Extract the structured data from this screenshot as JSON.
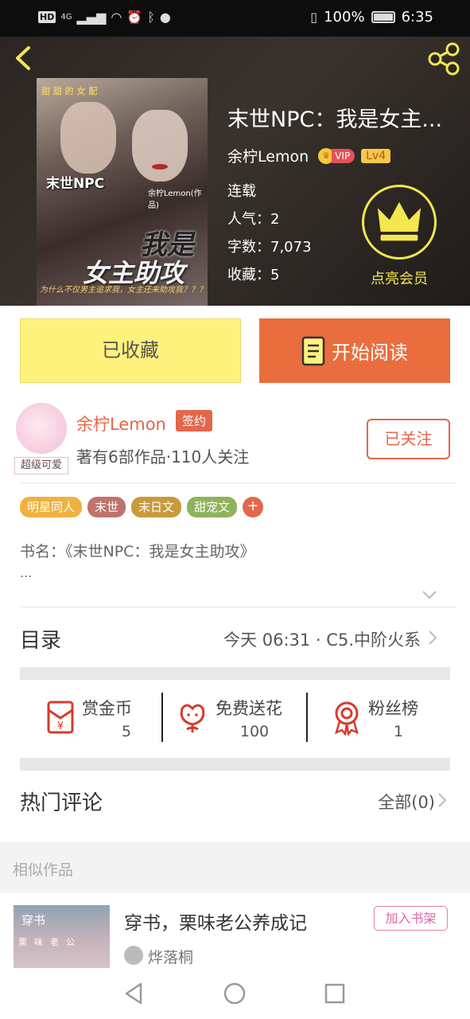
{
  "status_bar": {
    "hd": "HD",
    "network": "4G",
    "battery_pct": "100%",
    "time": "6:35"
  },
  "header": {
    "cover": {
      "top_text": "甜 甜 的 女 配",
      "title_line1": "末世NPC",
      "author": "余柠Lemon(作品)",
      "title_line2": "我是",
      "title_line3": "女主助攻",
      "tagline": "为什么不仅男主追求我，女主还来助攻我？？？"
    },
    "title": "末世NPC：我是女主...",
    "author": "余柠Lemon",
    "vip_label": "VIP",
    "level": "Lv4",
    "status": "连载",
    "popularity": "人气：2",
    "word_count": "字数：7,073",
    "favorites": "收藏：5",
    "vip_member_label": "点亮会员",
    "colors": {
      "accent_gold": "#f4e64e",
      "vip_red": "#e3515a"
    }
  },
  "actions": {
    "collected": "已收藏",
    "start_reading": "开始阅读"
  },
  "author_card": {
    "name": "余柠Lemon",
    "badge": "签约",
    "meta": "著有6部作品·110人关注",
    "avatar_tag": "超级可爱",
    "follow": "已关注"
  },
  "tags": [
    {
      "label": "明星同人",
      "color": "#f1b13f"
    },
    {
      "label": "末世",
      "color": "#c0736a"
    },
    {
      "label": "末日文",
      "color": "#c99a3c"
    },
    {
      "label": "甜宠文",
      "color": "#8fb25a"
    }
  ],
  "tag_more": "+",
  "synopsis": {
    "line1": "书名：《末世NPC：我是女主助攻》",
    "line2": "..."
  },
  "toc": {
    "label": "目录",
    "latest": "今天 06:31 · C5.中阶火系"
  },
  "stats": [
    {
      "label": "赏金币",
      "value": "5",
      "icon": "red-envelope-icon"
    },
    {
      "label": "免费送花",
      "value": "100",
      "icon": "flower-icon"
    },
    {
      "label": "粉丝榜",
      "value": "1",
      "icon": "medal-icon"
    }
  ],
  "comments": {
    "label": "热门评论",
    "all": "全部(0)"
  },
  "similar": {
    "label": "相似作品",
    "items": [
      {
        "title": "穿书，栗味老公养成记",
        "add_label": "加入书架",
        "author": "烨落桐",
        "cover_t1": "穿书",
        "cover_t2": "栗味老公"
      }
    ]
  }
}
